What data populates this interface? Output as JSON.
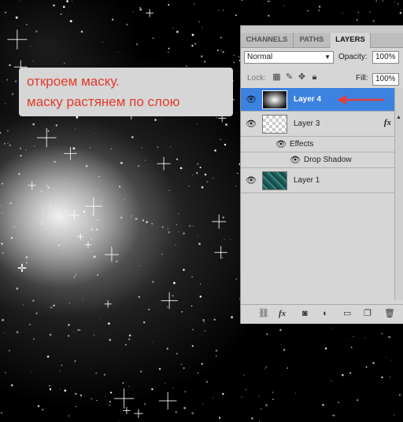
{
  "annotation": {
    "line1": "откроем маску.",
    "line2": "маску растянем по слою"
  },
  "panel": {
    "tabs": [
      {
        "label": "CHANNELS",
        "active": false
      },
      {
        "label": "PATHS",
        "active": false
      },
      {
        "label": "LAYERS",
        "active": true
      }
    ],
    "blend_mode": "Normal",
    "opacity_label": "Opacity:",
    "opacity_value": "100%",
    "lock_label": "Lock:",
    "fill_label": "Fill:",
    "fill_value": "100%",
    "layers": [
      {
        "name": "Layer 4",
        "selected": true,
        "thumb": "starfield"
      },
      {
        "name": "Layer 3",
        "selected": false,
        "thumb": "transparent",
        "fx": "fx"
      },
      {
        "name": "Effects",
        "kind": "effects-header"
      },
      {
        "name": "Drop Shadow",
        "kind": "effect"
      },
      {
        "name": "Layer 1",
        "selected": false,
        "thumb": "teal-texture"
      }
    ],
    "bottom_icons": [
      "link-icon",
      "fx-icon",
      "mask-icon",
      "adjustment-icon",
      "group-icon",
      "new-layer-icon",
      "trash-icon"
    ]
  },
  "colors": {
    "selected_row": "#3c82e0",
    "annotation_text": "#e23a2a",
    "panel_bg": "#d6d6d6"
  }
}
